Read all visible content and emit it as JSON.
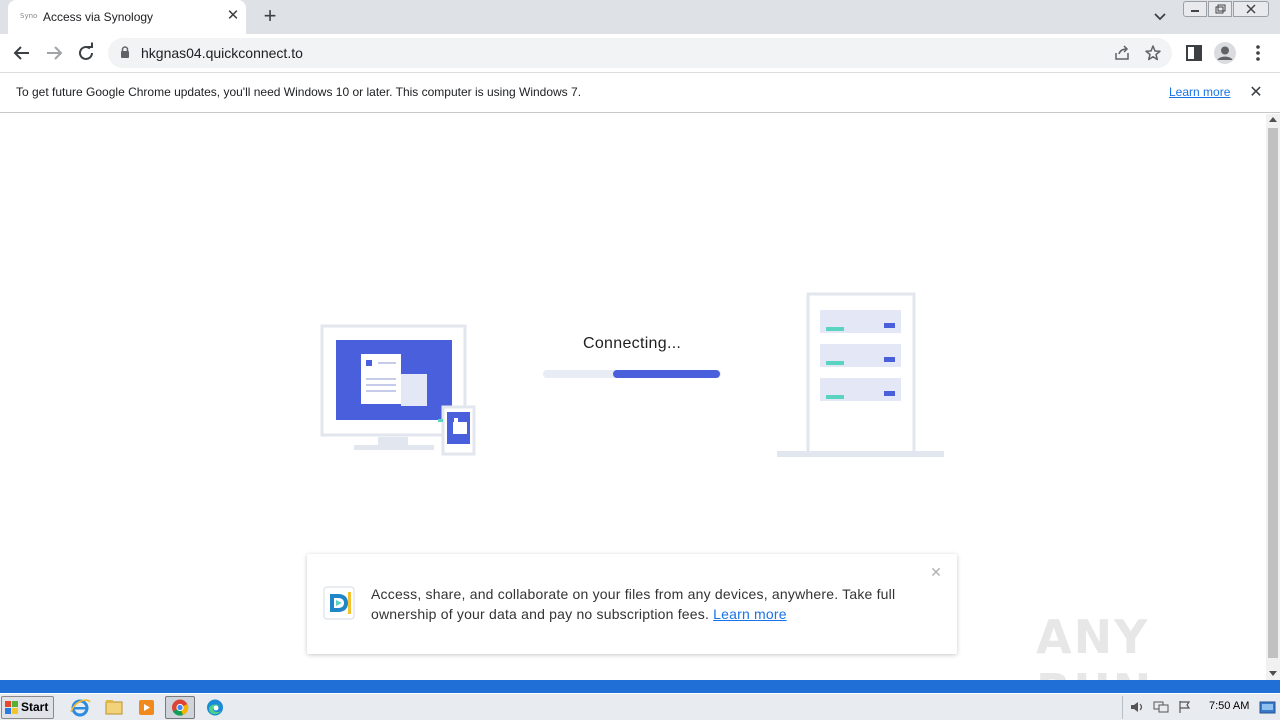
{
  "browser": {
    "tab": {
      "favicon_text": "Syno",
      "title": "Access via Synology",
      "close_glyph": "✕"
    },
    "new_tab_glyph": "+",
    "url": "hkgnas04.quickconnect.to",
    "icons": [
      "back-icon",
      "forward-icon",
      "reload-icon",
      "lock-icon",
      "share-icon",
      "star-icon",
      "side-panel-icon",
      "profile-icon",
      "menu-icon",
      "tab-search-icon"
    ]
  },
  "infobar": {
    "message": "To get future Google Chrome updates, you'll need Windows 10 or later. This computer is using Windows 7.",
    "link": "Learn more",
    "close_glyph": "✕"
  },
  "page": {
    "status": "Connecting...",
    "progress": 0.6,
    "accent_color": "#4a5fdc",
    "promo": {
      "text": "Access, share, and collaborate on your files from any devices, anywhere. Take full ownership of your data and pay no subscription fees.",
      "link": "Learn more",
      "close_glyph": "✕"
    }
  },
  "watermark": "ANY RUN",
  "taskbar": {
    "start_label": "Start",
    "clock": "7:50 AM",
    "apps": [
      "internet-explorer-icon",
      "file-explorer-icon",
      "media-player-icon",
      "chrome-icon",
      "edge-icon"
    ]
  }
}
